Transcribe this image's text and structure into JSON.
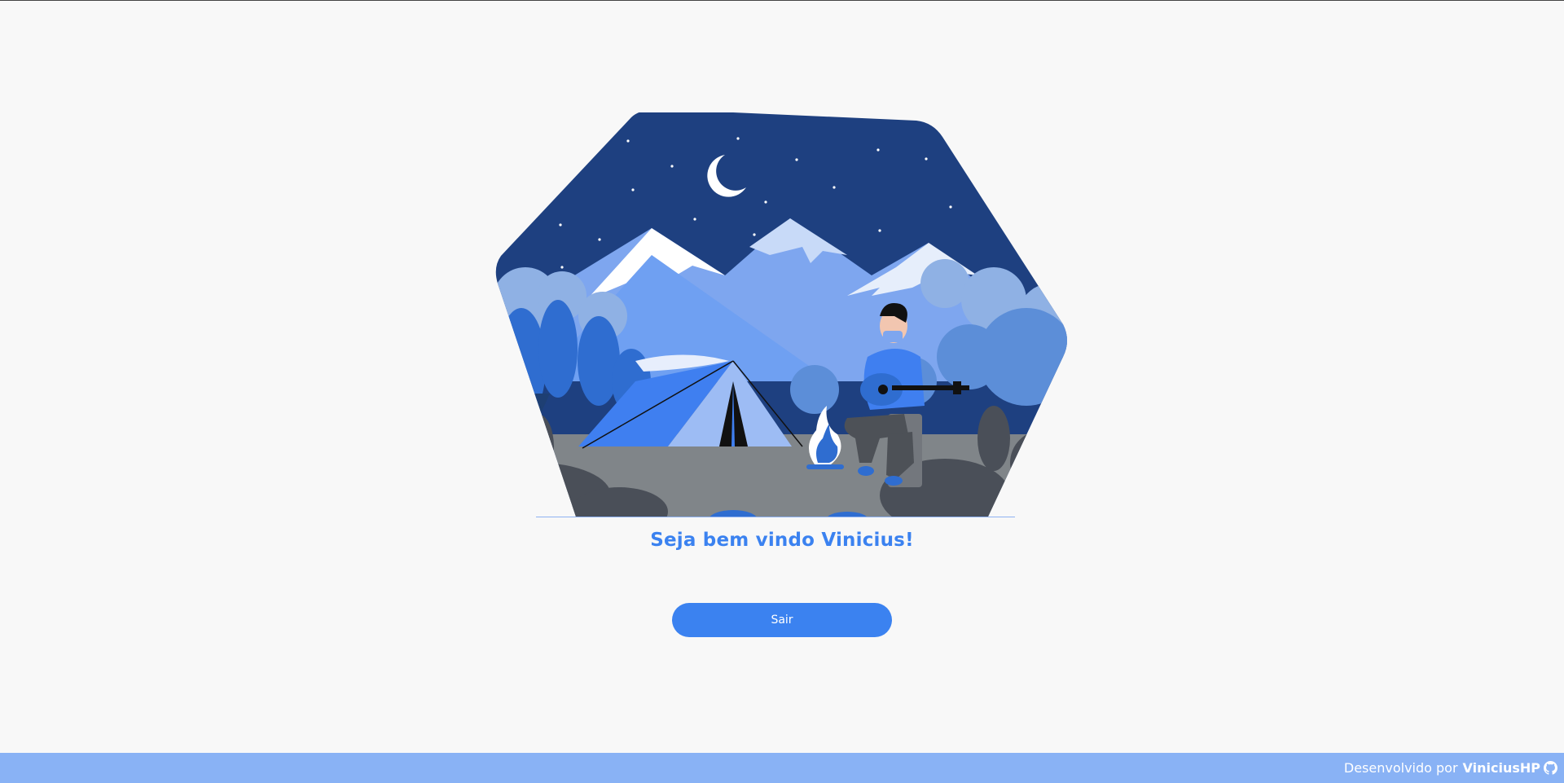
{
  "main": {
    "welcome_text": "Seja bem vindo Vinicius!",
    "logout_label": "Sair"
  },
  "footer": {
    "prefix": "Desenvolvido por",
    "author": "ViniciusHP",
    "icon": "github-icon"
  },
  "colors": {
    "background": "#f8f8f8",
    "accent": "#3b82f0",
    "footer": "#89b2f5",
    "night_sky": "#1e4080"
  }
}
